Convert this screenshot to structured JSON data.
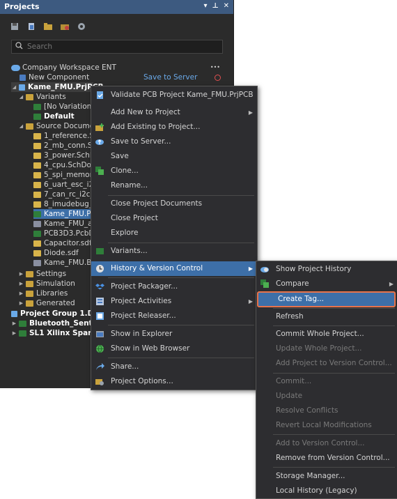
{
  "panel": {
    "title": "Projects",
    "controls": [
      "▾",
      "📌",
      "✕"
    ]
  },
  "toolbar": {
    "icons": [
      "save-icon",
      "open-project-icon",
      "open-folder-icon",
      "folder-settings-icon",
      "gear-icon"
    ]
  },
  "search": {
    "placeholder": "Search"
  },
  "tree": {
    "workspace": "Company Workspace ENT",
    "workspace_more": "•••",
    "new_component": "New Component",
    "save_to_server": "Save to Server",
    "project": "Kame_FMU.PrjPCB",
    "variants": "Variants",
    "no_variations": "[No Variations]",
    "default": "Default",
    "source_docs": "Source Documen",
    "docs": [
      "1_reference.Sch",
      "2_mb_conn.Sch",
      "3_power.SchDo",
      "4_cpu.SchDoc",
      "5_spi_memory.",
      "6_uart_esc_i2c",
      "7_can_rc_i2c_ar",
      "8_imudebug_c",
      "Kame_FMU.Pcb",
      "Kame_FMU_asm",
      "PCB3D3.PcbDo",
      "Capacitor.sdf",
      "Diode.sdf",
      "Kame_FMU.Bom"
    ],
    "folders": [
      "Settings",
      "Simulation",
      "Libraries",
      "Generated"
    ],
    "group": "Project Group 1.DsnW",
    "bluetooth": "Bluetooth_Sentinel",
    "xilinx": "SL1 Xilinx Spartan-I"
  },
  "menu": {
    "validate": "Validate PCB Project Kame_FMU.PrjPCB",
    "add_new": "Add New to Project",
    "add_existing": "Add Existing to Project...",
    "save_server": "Save to Server...",
    "save": "Save",
    "clone": "Clone...",
    "rename": "Rename...",
    "close_docs": "Close Project Documents",
    "close_project": "Close Project",
    "explore": "Explore",
    "variants": "Variants...",
    "history": "History & Version Control",
    "packager": "Project Packager...",
    "activities": "Project Activities",
    "releaser": "Project Releaser...",
    "show_explorer": "Show in Explorer",
    "show_browser": "Show in Web Browser",
    "share": "Share...",
    "options": "Project Options..."
  },
  "submenu": {
    "show_history": "Show Project History",
    "compare": "Compare",
    "create_tag": "Create Tag...",
    "refresh": "Refresh",
    "commit_whole": "Commit Whole Project...",
    "update_whole": "Update Whole Project...",
    "add_vc": "Add Project to Version Control...",
    "commit": "Commit...",
    "update": "Update",
    "resolve": "Resolve Conflicts",
    "revert": "Revert Local Modifications",
    "add_to_vc": "Add to Version Control...",
    "remove_vc": "Remove from Version Control...",
    "storage": "Storage Manager...",
    "local_history": "Local History (Legacy)"
  },
  "colors": {
    "accent": "#3d6fa8",
    "highlight_outline": "#e8734a"
  }
}
